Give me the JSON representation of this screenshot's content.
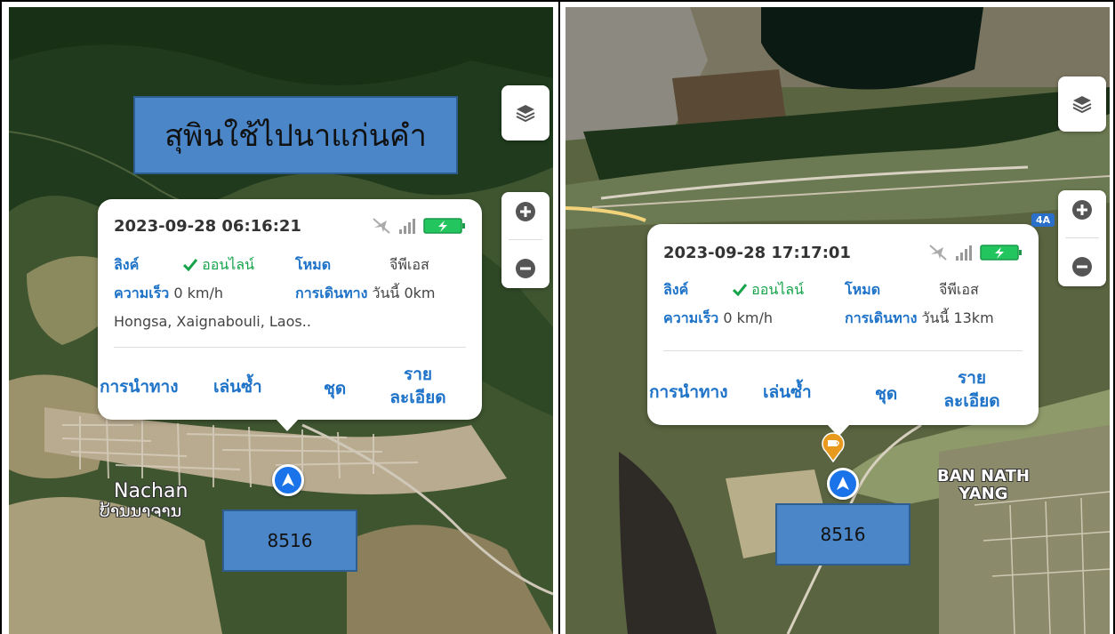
{
  "left_panel": {
    "title_caption": "สุพินใช้ไปนาแก่นคำ",
    "device_caption": "8516",
    "popup": {
      "datetime": "2023-09-28 06:16:21",
      "link_label": "ลิงค์",
      "link_value": "ออนไลน์",
      "mode_label": "โหมด",
      "mode_value": "จีพีเอส",
      "speed_label": "ความเร็ว",
      "speed_value": "0 km/h",
      "trip_label": "การเดินทาง",
      "trip_value": "วันนี้ 0km",
      "address": "Hongsa, Xaignabouli, Laos..",
      "actions": {
        "navigate": "การนำทาง",
        "replay": "เล่นซ้ำ",
        "set": "ชุด",
        "details_line1": "ราย",
        "details_line2": "ละเอียด"
      }
    },
    "place_label_en": "Nachan",
    "place_label_local": "ບ້ານນາຈານ"
  },
  "right_panel": {
    "device_caption": "8516",
    "popup": {
      "datetime": "2023-09-28 17:17:01",
      "link_label": "ลิงค์",
      "link_value": "ออนไลน์",
      "mode_label": "โหมด",
      "mode_value": "จีพีเอส",
      "speed_label": "ความเร็ว",
      "speed_value": "0 km/h",
      "trip_label": "การเดินทาง",
      "trip_value": "วันนี้ 13km",
      "actions": {
        "navigate": "การนำทาง",
        "replay": "เล่นซ้ำ",
        "set": "ชุด",
        "details_line1": "ราย",
        "details_line2": "ละเอียด"
      }
    },
    "place_label_line1": "BAN NATH",
    "place_label_line2": "YANG",
    "road_badge": "4A"
  },
  "icons": {
    "layers": "layers-icon",
    "zoom_in": "zoom-in-icon",
    "zoom_out": "zoom-out-icon",
    "gps_off": "gps-off-icon",
    "signal": "signal-icon",
    "battery": "battery-charging-icon",
    "check": "check-icon",
    "navigation_arrow": "navigation-arrow-icon",
    "cafe": "cafe-icon"
  },
  "colors": {
    "accent": "#1e73c8",
    "online": "#16a34a",
    "caption_fill": "#4a86c8",
    "battery": "#22c55e"
  }
}
